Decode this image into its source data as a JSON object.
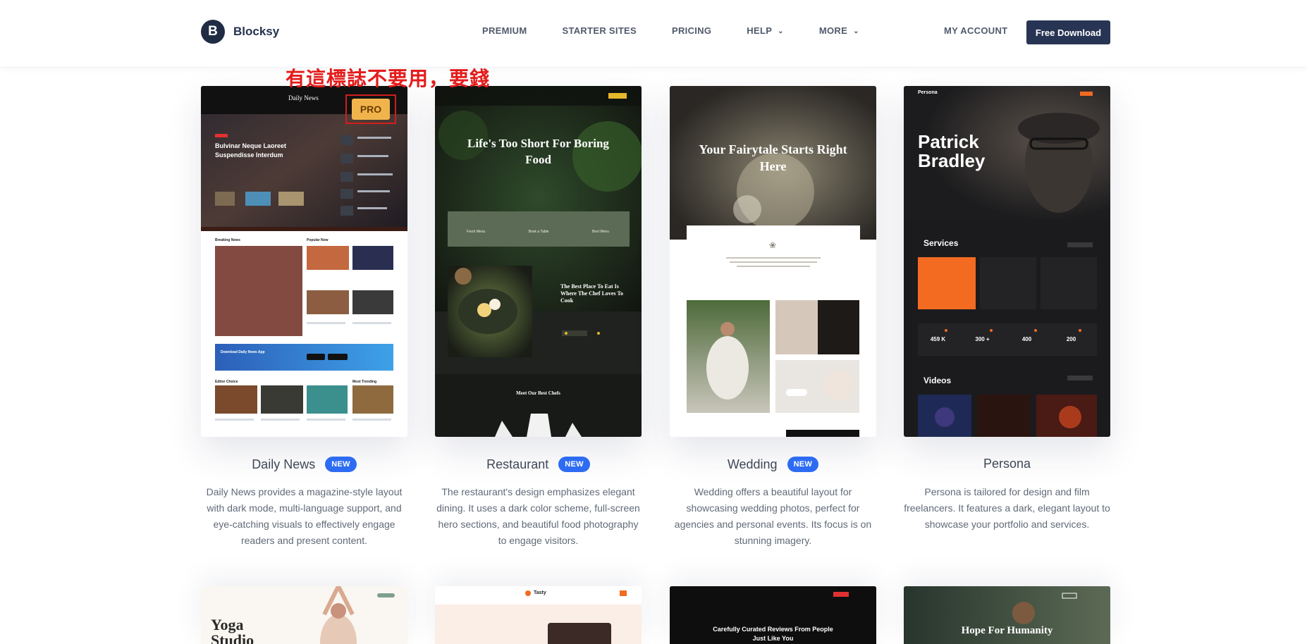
{
  "header": {
    "logo_letter": "B",
    "brand": "Blocksy",
    "nav": [
      "PREMIUM",
      "STARTER SITES",
      "PRICING",
      "HELP",
      "MORE"
    ],
    "account": "MY ACCOUNT",
    "cta": "Free Download"
  },
  "annotation": "有這標誌不要用，要錢",
  "cards": [
    {
      "name": "Daily News",
      "badge": "NEW",
      "description": "Daily News provides a magazine-style layout with dark mode, multi-language support, and eye-catching visuals to effectively engage readers and present content.",
      "pro": "PRO",
      "preview": {
        "site_title": "Daily News",
        "headline": "Bulvinar Neque Laoreet Suspendisse Interdum",
        "sec1": "Breaking News",
        "sec2": "Popular Now",
        "app": "Download Daily News App",
        "sec3": "Editor Choice",
        "sec4": "Most Trending"
      }
    },
    {
      "name": "Restaurant",
      "badge": "NEW",
      "description": "The restaurant's design emphasizes elegant dining. It uses a dark color scheme, full-screen hero sections, and beautiful food photography to engage visitors.",
      "preview": {
        "hero": "Life's Too Short For Boring Food",
        "features": [
          "Fresh Menu",
          "Book a Table",
          "Best Menu"
        ],
        "heading": "The Best Place To Eat Is Where The Chef Loves To Cook",
        "chefs": "Meet Our Best Chefs"
      }
    },
    {
      "name": "Wedding",
      "badge": "NEW",
      "description": "Wedding offers a beautiful layout for showcasing wedding photos, perfect for agencies and personal events. Its focus is on stunning imagery.",
      "preview": {
        "hero": "Your Fairytale Starts Right Here"
      }
    },
    {
      "name": "Persona",
      "description": "Persona is tailored for design and film freelancers. It features a dark, elegant layout to showcase your portfolio and services.",
      "preview": {
        "brand": "Persona",
        "hero": "Patrick Bradley",
        "services": "Services",
        "stats": [
          "459 K",
          "300 +",
          "400",
          "200"
        ],
        "videos": "Videos"
      }
    }
  ],
  "row2": {
    "yoga": "Yoga Studio",
    "tasty": "Tasty",
    "reviews": "Carefully Curated Reviews From People Just Like You",
    "charity": "Hope For Humanity"
  }
}
